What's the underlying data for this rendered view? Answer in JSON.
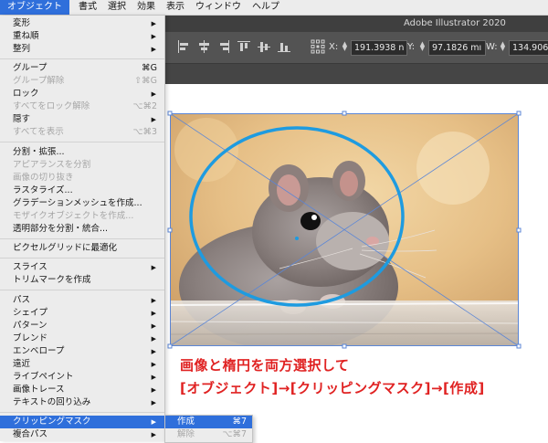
{
  "menubar": {
    "items": [
      "オブジェクト",
      "書式",
      "選択",
      "効果",
      "表示",
      "ウィンドウ",
      "ヘルプ"
    ]
  },
  "app": {
    "title": "Adobe Illustrator 2020"
  },
  "toolbar": {
    "x_label": "X:",
    "x_value": "191.3938 n",
    "y_label": "Y:",
    "y_value": "97.1826 mı",
    "w_label": "W:",
    "w_value": "134.906"
  },
  "menu": {
    "transform": "変形",
    "arrange": "重ね順",
    "align": "整列",
    "group": "グループ",
    "group_sc": "⌘G",
    "ungroup": "グループ解除",
    "ungroup_sc": "⇧⌘G",
    "lock": "ロック",
    "unlock_all": "すべてをロック解除",
    "unlock_all_sc": "⌥⌘2",
    "hide": "隠す",
    "show_all": "すべてを表示",
    "show_all_sc": "⌥⌘3",
    "expand": "分割・拡張...",
    "expand_appearance": "アピアランスを分割",
    "crop_image": "画像の切り抜き",
    "rasterize": "ラスタライズ...",
    "gradient_mesh": "グラデーションメッシュを作成...",
    "object_mosaic": "モザイクオブジェクトを作成...",
    "flatten_transparency": "透明部分を分割・統合...",
    "pixel_optimize": "ピクセルグリッドに最適化",
    "slice": "スライス",
    "trim_marks": "トリムマークを作成",
    "path": "パス",
    "shape": "シェイプ",
    "pattern": "パターン",
    "blend": "ブレンド",
    "envelope": "エンベロープ",
    "perspective": "遠近",
    "live_paint": "ライブペイント",
    "image_trace": "画像トレース",
    "text_wrap": "テキストの回り込み",
    "clipping_mask": "クリッピングマスク",
    "compound_path": "複合パス"
  },
  "submenu": {
    "make": "作成",
    "make_sc": "⌘7",
    "release": "解除",
    "release_sc": "⌥⌘7"
  },
  "caption": {
    "line1": "画像と楕円を両方選択して",
    "line2": "[オブジェクト]→[クリッピングマスク]→[作成]"
  },
  "colors": {
    "accent": "#2f6fdb",
    "caption": "#e02222",
    "ellipse": "#1e9be0"
  }
}
